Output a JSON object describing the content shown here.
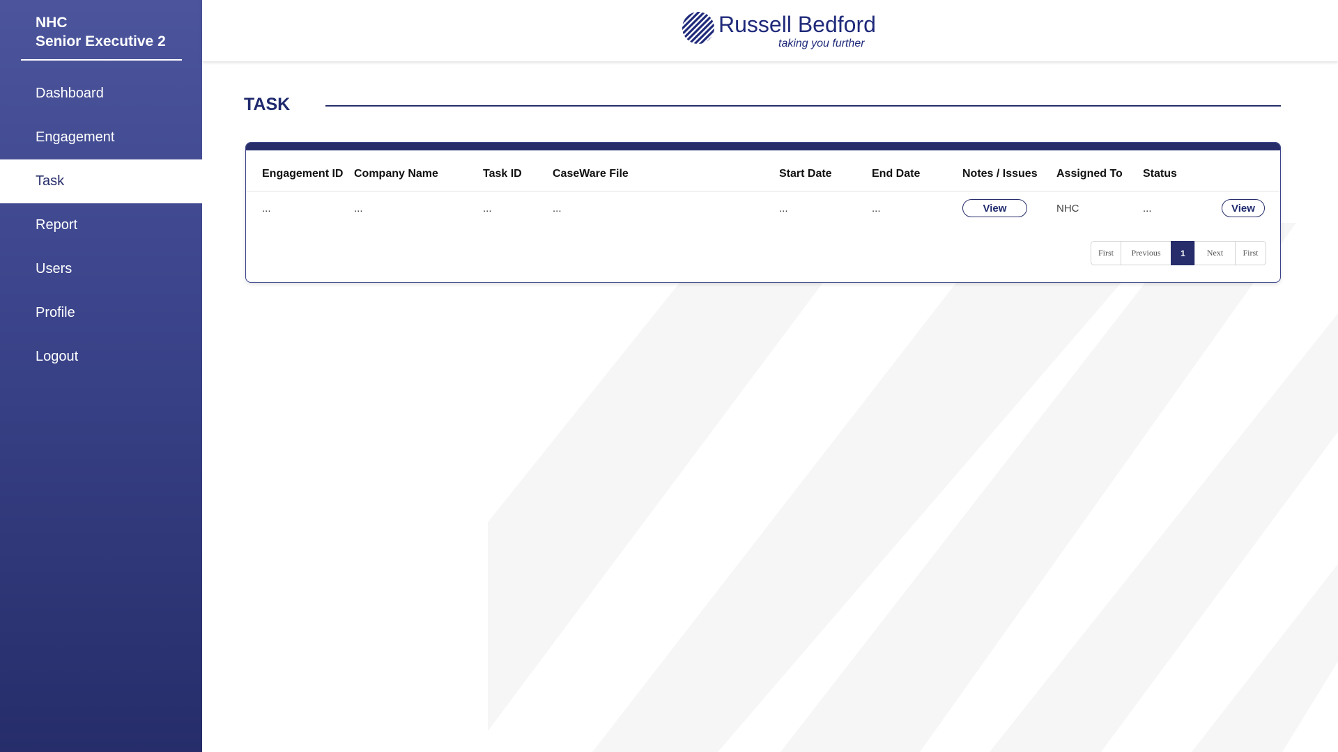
{
  "sidebar": {
    "user_line1": "NHC",
    "user_line2": "Senior Executive 2",
    "items": [
      {
        "label": "Dashboard"
      },
      {
        "label": "Engagement"
      },
      {
        "label": "Task"
      },
      {
        "label": "Report"
      },
      {
        "label": "Users"
      },
      {
        "label": "Profile"
      },
      {
        "label": "Logout"
      }
    ],
    "active": "Task"
  },
  "header": {
    "logo_name": "Russell Bedford",
    "logo_tagline": "taking you further"
  },
  "main": {
    "title": "TASK",
    "table": {
      "columns": [
        "Engagement ID",
        "Company Name",
        "Task ID",
        "CaseWare File",
        "Start Date",
        "End Date",
        "Notes / Issues",
        "Assigned To",
        "Status"
      ],
      "rows": [
        {
          "engagement_id": "...",
          "company_name": "...",
          "task_id": "...",
          "caseware_file": "...",
          "start_date": "...",
          "end_date": "...",
          "notes_button": "View",
          "assigned_to": "NHC",
          "status": "...",
          "action_button": "View"
        }
      ]
    },
    "pagination": {
      "first": "First",
      "previous": "Previous",
      "current": "1",
      "next": "Next",
      "last": "First"
    }
  },
  "colors": {
    "primary": "#262d6a",
    "sidebar_top": "#4c559c",
    "sidebar_bottom": "#262d6a",
    "brand_text": "#1f2a7a"
  }
}
